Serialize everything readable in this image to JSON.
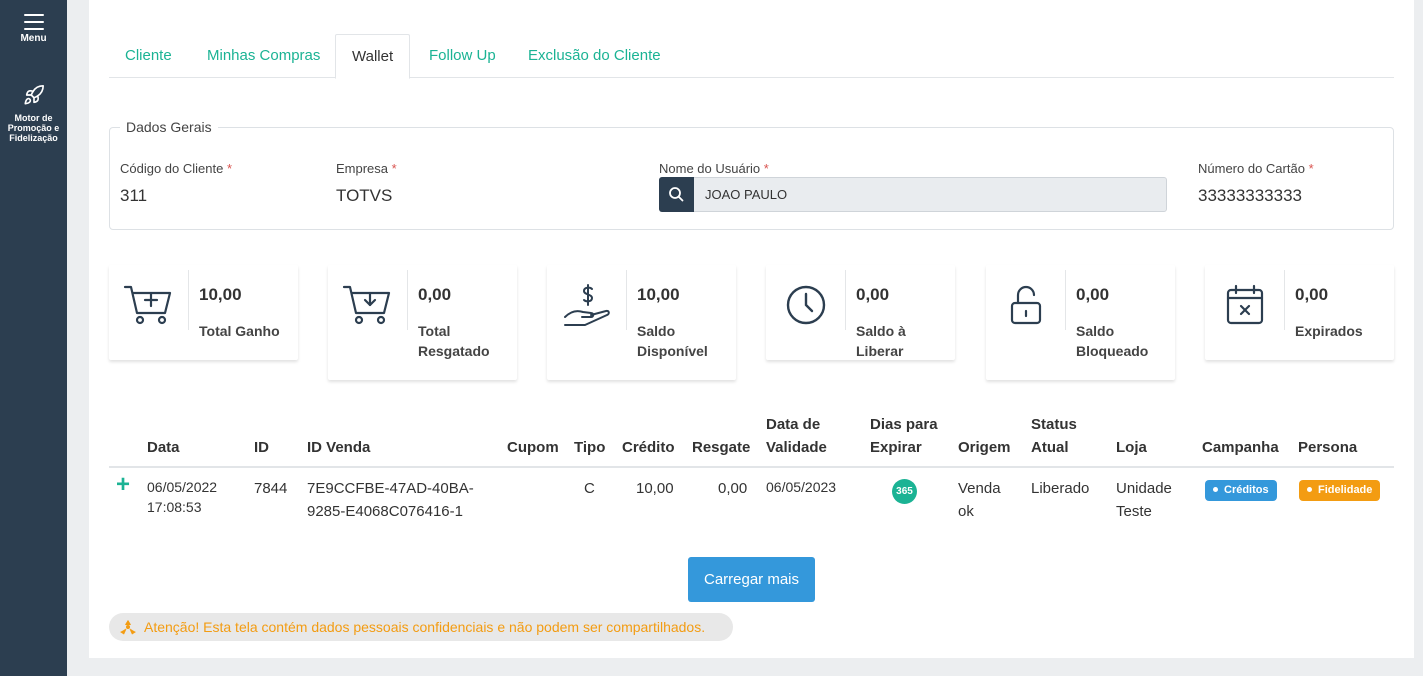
{
  "sidebar": {
    "menu_label": "Menu",
    "motor_label_line1": "Motor de",
    "motor_label_line2": "Promoção e",
    "motor_label_line3": "Fidelização"
  },
  "tabs": [
    {
      "label": "Cliente",
      "active": false
    },
    {
      "label": "Minhas Compras",
      "active": false
    },
    {
      "label": "Wallet",
      "active": true
    },
    {
      "label": "Follow Up",
      "active": false
    },
    {
      "label": "Exclusão do Cliente",
      "active": false
    }
  ],
  "dados_gerais": {
    "legend": "Dados Gerais",
    "codigo_label": "Código do Cliente",
    "codigo_value": "311",
    "empresa_label": "Empresa",
    "empresa_value": "TOTVS",
    "usuario_label": "Nome do Usuário",
    "usuario_value": "JOAO PAULO",
    "cartao_label": "Número do Cartão",
    "cartao_value": "33333333333",
    "required_mark": "*"
  },
  "summary_cards": [
    {
      "value": "10,00",
      "caption": "Total Ganho",
      "icon": "cart-plus-icon"
    },
    {
      "value": "0,00",
      "caption": "Total Resgatado",
      "icon": "cart-download-icon"
    },
    {
      "value": "10,00",
      "caption": "Saldo Disponível",
      "icon": "hand-dollar-icon"
    },
    {
      "value": "0,00",
      "caption": "Saldo à Liberar",
      "icon": "clock-icon"
    },
    {
      "value": "0,00",
      "caption": "Saldo Bloqueado",
      "icon": "unlock-icon"
    },
    {
      "value": "0,00",
      "caption": "Expirados",
      "icon": "calendar-x-icon"
    }
  ],
  "table": {
    "headers": {
      "data": "Data",
      "id": "ID",
      "id_venda": "ID Venda",
      "cupom": "Cupom",
      "tipo": "Tipo",
      "credito": "Crédito",
      "resgate": "Resgate",
      "validade_1": "Data de",
      "validade_2": "Validade",
      "dias_1": "Dias para",
      "dias_2": "Expirar",
      "origem": "Origem",
      "status_1": "Status",
      "status_2": "Atual",
      "loja": "Loja",
      "campanha": "Campanha",
      "persona": "Persona"
    },
    "rows": [
      {
        "expand": "+",
        "data_1": "06/05/2022",
        "data_2": "17:08:53",
        "id": "7844",
        "id_venda_1": "7E9CCFBE-47AD-40BA-",
        "id_venda_2": "9285-E4068C076416-1",
        "cupom": "",
        "tipo": "C",
        "credito": "10,00",
        "resgate": "0,00",
        "validade": "06/05/2023",
        "dias": "365",
        "origem_1": "Venda",
        "origem_2": "ok",
        "status": "Liberado",
        "loja_1": "Unidade",
        "loja_2": "Teste",
        "campanha": "Créditos",
        "persona": "Fidelidade"
      }
    ]
  },
  "load_more_label": "Carregar mais",
  "alert_text": "Atenção! Esta tela contém dados pessoais confidenciais e não podem ser compartilhados.",
  "colors": {
    "accent": "#1bb394",
    "sidebar": "#2c3e50",
    "primary_button": "#3498db",
    "campanha_pill": "#3498db",
    "persona_pill": "#f39c12",
    "warning": "#f39c12"
  }
}
